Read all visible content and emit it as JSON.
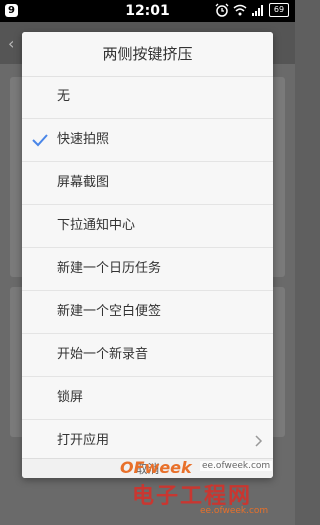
{
  "status_bar": {
    "notification_badge": "9",
    "time": "12:01",
    "battery": "69",
    "icons": [
      "alarm-icon",
      "wifi-icon",
      "signal-icon",
      "battery-icon"
    ]
  },
  "dialog": {
    "title": "两侧按键挤压",
    "options": [
      {
        "label": "无",
        "selected": false
      },
      {
        "label": "快速拍照",
        "selected": true
      },
      {
        "label": "屏幕截图",
        "selected": false
      },
      {
        "label": "下拉通知中心",
        "selected": false
      },
      {
        "label": "新建一个日历任务",
        "selected": false
      },
      {
        "label": "新建一个空白便签",
        "selected": false
      },
      {
        "label": "开始一个新录音",
        "selected": false
      },
      {
        "label": "锁屏",
        "selected": false
      },
      {
        "label": "打开应用",
        "selected": false,
        "has_submenu": true
      }
    ],
    "cancel_label": "取消"
  },
  "watermark": {
    "brand": "OFweek",
    "url": "ee.ofweek.com",
    "title": "电子工程网",
    "site": "ee.ofweek.com"
  },
  "colors": {
    "check": "#4a86e8",
    "watermark_brand": "#e8702a",
    "watermark_title": "#d3322b"
  }
}
